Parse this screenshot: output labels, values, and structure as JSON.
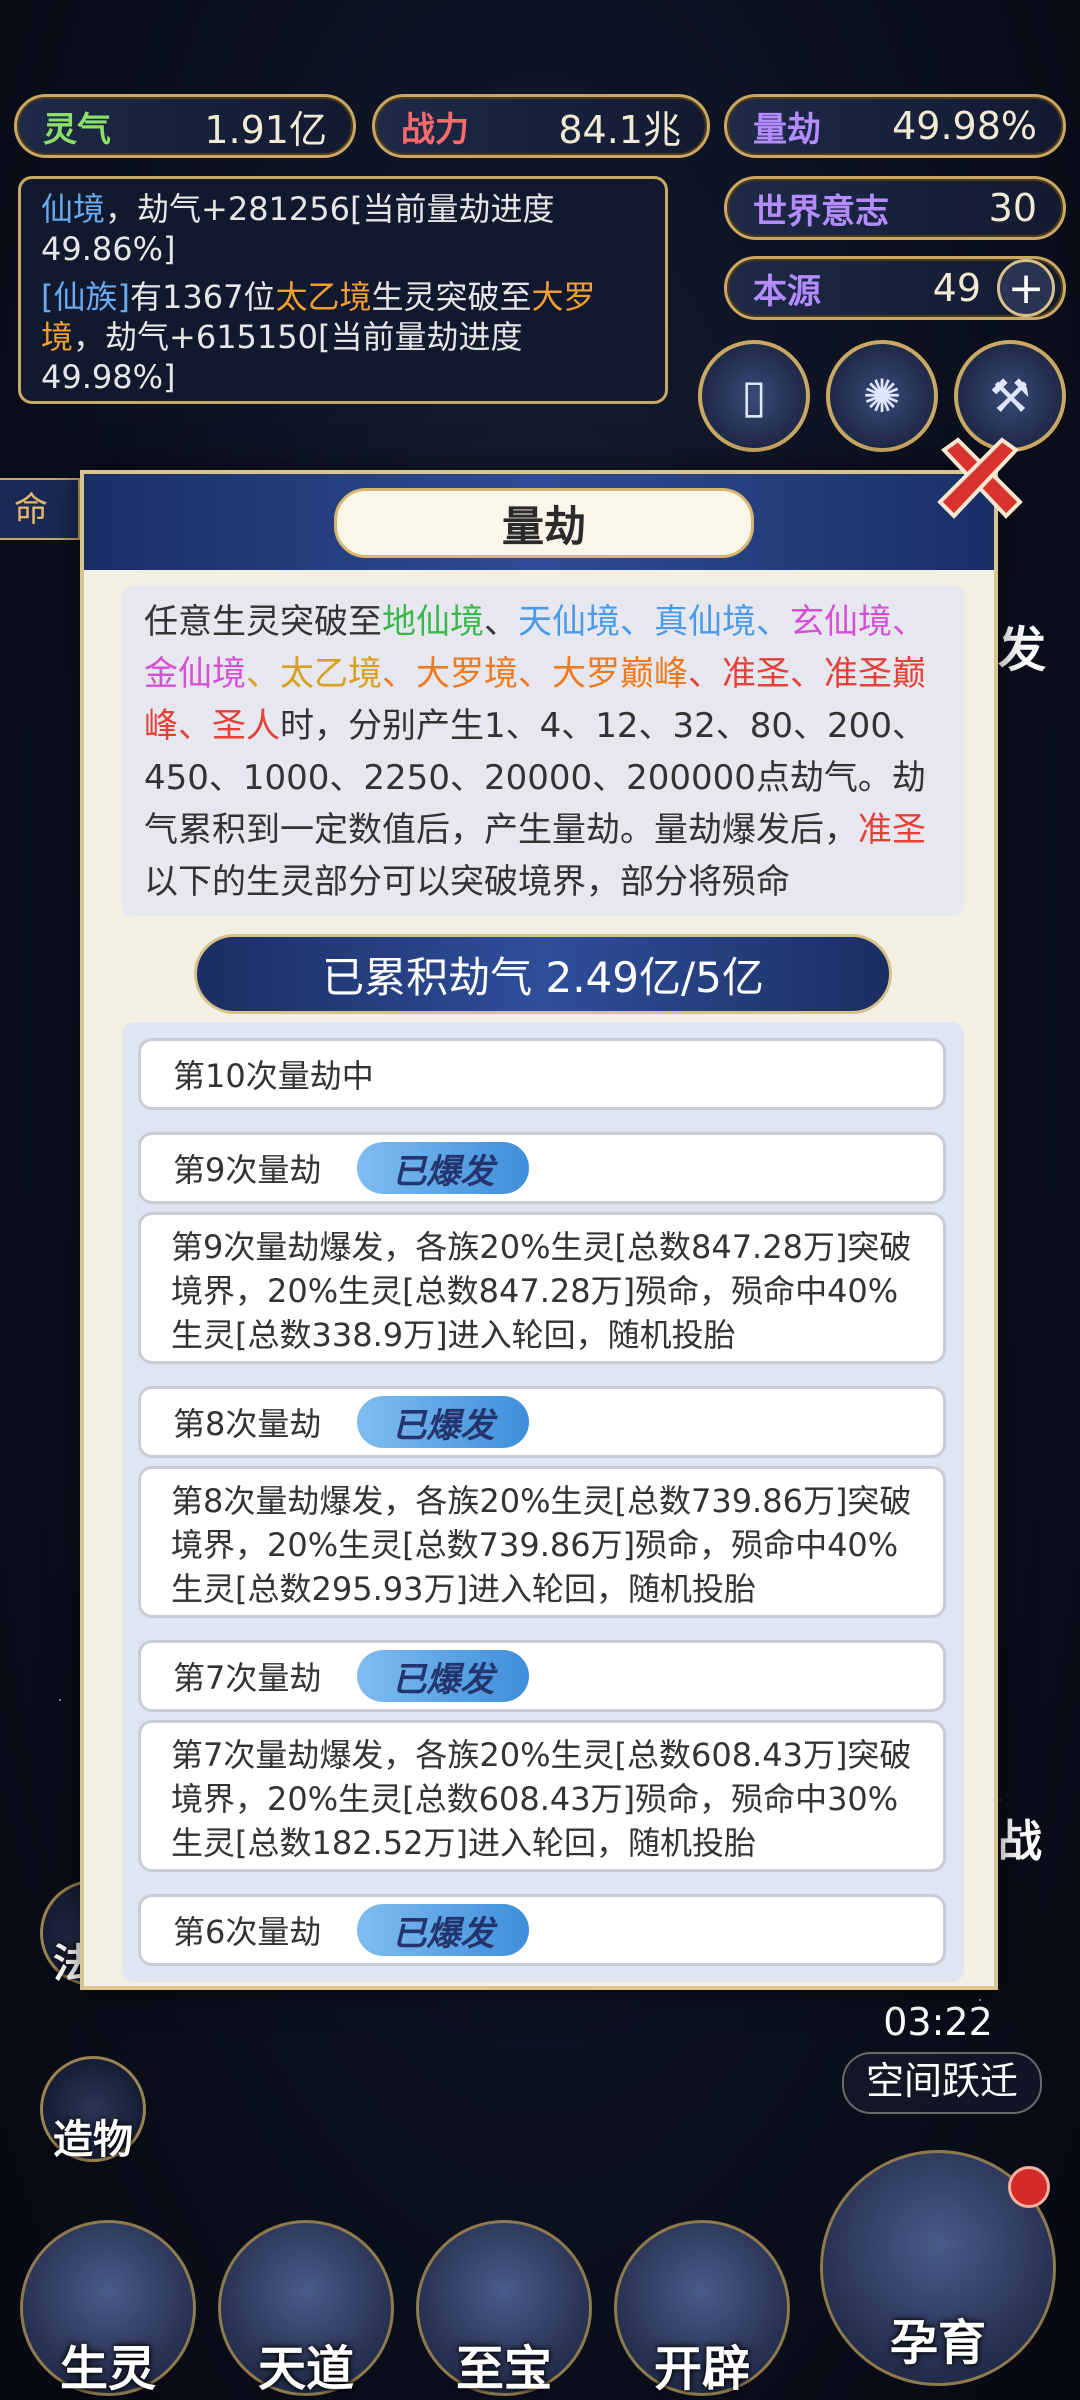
{
  "stats": {
    "lingqi": {
      "label": "灵气",
      "value": "1.91亿"
    },
    "zhanli": {
      "label": "战力",
      "value": "84.1兆"
    },
    "liangjie": {
      "label": "量劫",
      "value": "49.98%"
    },
    "world_will": {
      "label": "世界意志",
      "value": "30"
    },
    "origin": {
      "label": "本源",
      "value": "49",
      "plus": "+"
    }
  },
  "log": {
    "line1": {
      "realm": "仙境",
      "text": "，劫气+281256[当前量劫进度49.86%]"
    },
    "line2": {
      "race": "[仙族]",
      "p1": "有1367位",
      "realm1": "太乙境",
      "p2": "生灵突破至",
      "realm2": "大罗境",
      "p3": "，劫气+615150[当前量劫进度49.98%]"
    }
  },
  "left_tab": "命",
  "right_side": {
    "fa": "发",
    "zhan": "战"
  },
  "modal": {
    "title": "量劫",
    "desc": {
      "p1": "任意生灵突破至",
      "r1": "地仙境",
      "s1": "、",
      "r2": "天仙境",
      "s2": "、",
      "r3": "真仙境",
      "s3": "、",
      "r4": "玄仙境",
      "s4": "、",
      "r5": "金仙境",
      "s5": "、",
      "r6": "太乙境",
      "s6": "、",
      "r7": "大罗境",
      "s7": "、",
      "r8": "大罗巅峰",
      "s8": "、",
      "r9": "准圣",
      "s9": "、",
      "r10": "准圣巅峰",
      "s10": "、",
      "r11": "圣人",
      "p2": "时，分别产生1、4、12、32、80、200、450、1000、2250、20000、200000点劫气。劫气累积到一定数值后，产生量劫。量劫爆发后，",
      "r12": "准圣",
      "p3": "以下的生灵部分可以突破境界，部分将殒命"
    },
    "total": "已累积劫气 2.49亿/5亿",
    "entries": [
      {
        "title": "第10次量劫中"
      },
      {
        "title": "第9次量劫",
        "badge": "已爆发",
        "detail": "第9次量劫爆发，各族20%生灵[总数847.28万]突破境界，20%生灵[总数847.28万]殒命，殒命中40%生灵[总数338.9万]进入轮回，随机投胎"
      },
      {
        "title": "第8次量劫",
        "badge": "已爆发",
        "detail": "第8次量劫爆发，各族20%生灵[总数739.86万]突破境界，20%生灵[总数739.86万]殒命，殒命中40%生灵[总数295.93万]进入轮回，随机投胎"
      },
      {
        "title": "第7次量劫",
        "badge": "已爆发",
        "detail": "第7次量劫爆发，各族20%生灵[总数608.43万]突破境界，20%生灵[总数608.43万]殒命，殒命中30%生灵[总数182.52万]进入轮回，随机投胎"
      },
      {
        "title": "第6次量劫",
        "badge": "已爆发"
      }
    ]
  },
  "side_buttons": [
    "法则",
    "造物"
  ],
  "timer": "03:22",
  "space_jump": "空间跃迁",
  "bottom_nav": [
    "生灵",
    "天道",
    "至宝",
    "开辟",
    "孕育"
  ]
}
